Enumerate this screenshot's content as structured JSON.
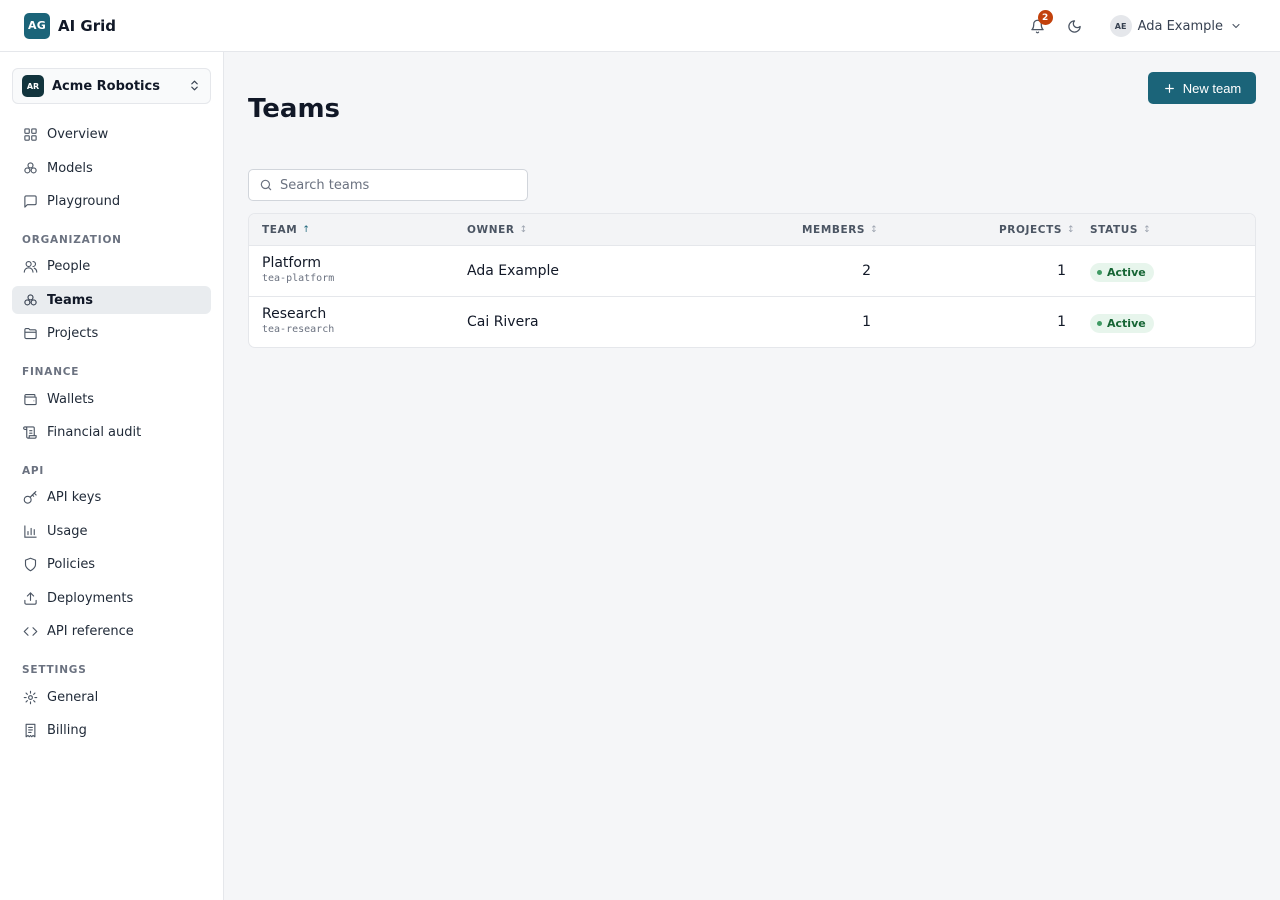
{
  "app": {
    "logo_initials": "AG",
    "name": "AI Grid"
  },
  "header": {
    "notifications_count": "2",
    "user": {
      "initials": "AE",
      "name": "Ada Example"
    }
  },
  "sidebar": {
    "org": {
      "initials": "AR",
      "name": "Acme Robotics"
    },
    "items": [
      {
        "label": "Overview",
        "icon": "grid-icon"
      },
      {
        "label": "Models",
        "icon": "models-icon"
      },
      {
        "label": "Playground",
        "icon": "chat-icon"
      }
    ],
    "sections": [
      {
        "title": "ORGANIZATION",
        "items": [
          {
            "label": "People",
            "icon": "people-icon"
          },
          {
            "label": "Teams",
            "icon": "teams-icon",
            "active": true
          },
          {
            "label": "Projects",
            "icon": "folder-icon"
          }
        ]
      },
      {
        "title": "FINANCE",
        "items": [
          {
            "label": "Wallets",
            "icon": "wallet-icon"
          },
          {
            "label": "Financial audit",
            "icon": "scroll-icon"
          }
        ]
      },
      {
        "title": "API",
        "items": [
          {
            "label": "API keys",
            "icon": "key-icon"
          },
          {
            "label": "Usage",
            "icon": "bar-chart-icon"
          },
          {
            "label": "Policies",
            "icon": "shield-icon"
          },
          {
            "label": "Deployments",
            "icon": "upload-icon"
          },
          {
            "label": "API reference",
            "icon": "code-icon"
          }
        ]
      },
      {
        "title": "SETTINGS",
        "items": [
          {
            "label": "General",
            "icon": "gear-icon"
          },
          {
            "label": "Billing",
            "icon": "receipt-icon"
          }
        ]
      }
    ]
  },
  "main": {
    "title": "Teams",
    "new_button": "New team",
    "search_placeholder": "Search teams",
    "table": {
      "columns": [
        "TEAM",
        "OWNER",
        "MEMBERS",
        "PROJECTS",
        "STATUS"
      ],
      "sort_glyphs": {
        "asc": "↑",
        "none": "↕"
      },
      "rows": [
        {
          "name": "Platform",
          "slug": "tea-platform",
          "owner": "Ada Example",
          "members": "2",
          "projects": "1",
          "status": "Active"
        },
        {
          "name": "Research",
          "slug": "tea-research",
          "owner": "Cai Rivera",
          "members": "1",
          "projects": "1",
          "status": "Active"
        }
      ]
    }
  },
  "colors": {
    "accent": "#1b6479",
    "badge_bg": "#e7f5ec",
    "badge_text": "#166534",
    "notification": "#c2410c"
  }
}
